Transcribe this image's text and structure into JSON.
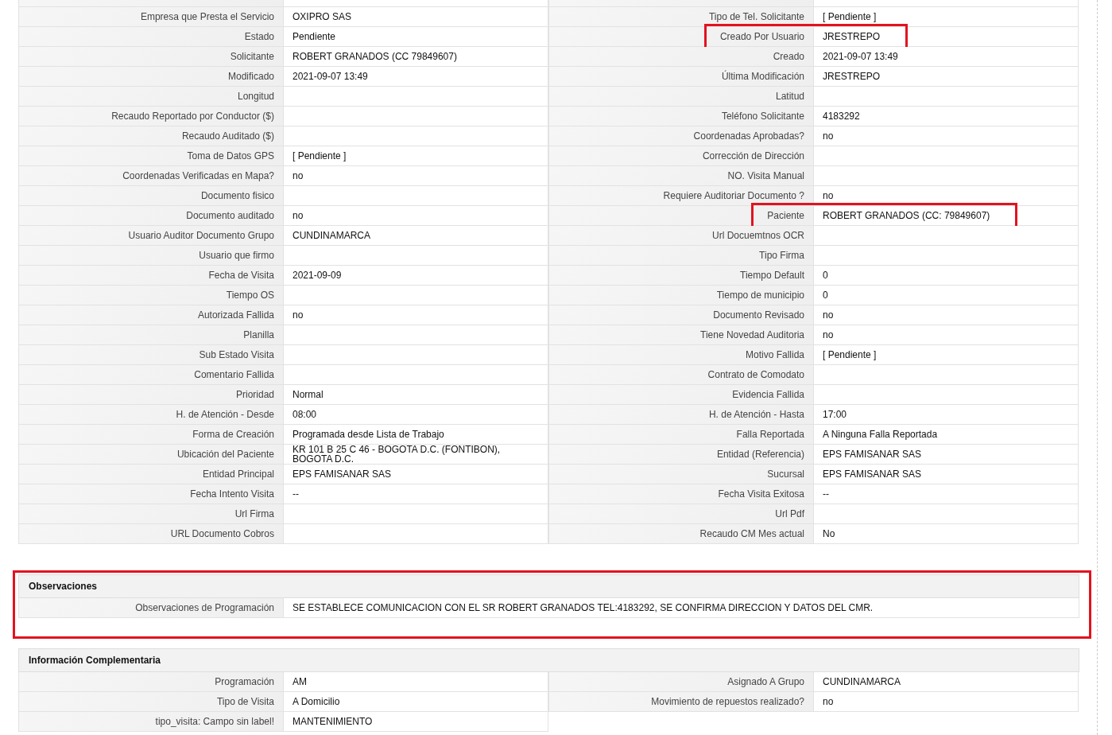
{
  "details": {
    "rows": [
      {
        "left": {
          "label": "Empresa que Presta el Servicio",
          "value": "OXIPRO SAS",
          "highlighted": false
        },
        "right": {
          "label": "Tipo de Tel. Solicitante",
          "value": "[ Pendiente ]",
          "highlighted": false
        }
      },
      {
        "left": {
          "label": "Estado",
          "value": "Pendiente",
          "highlighted": false
        },
        "right": {
          "label": "Creado Por Usuario",
          "value": "JRESTREPO",
          "highlighted": true
        }
      },
      {
        "left": {
          "label": "Solicitante",
          "value": "ROBERT GRANADOS (CC 79849607)",
          "highlighted": false
        },
        "right": {
          "label": "Creado",
          "value": "2021-09-07 13:49",
          "highlighted": false
        }
      },
      {
        "left": {
          "label": "Modificado",
          "value": "2021-09-07 13:49",
          "highlighted": false
        },
        "right": {
          "label": "Última Modificación",
          "value": "JRESTREPO",
          "highlighted": false
        }
      },
      {
        "left": {
          "label": "Longitud",
          "highlighted": false
        },
        "right": {
          "label": "Latitud",
          "highlighted": false
        }
      },
      {
        "left": {
          "label": "Recaudo Reportado por Conductor ($)",
          "highlighted": false
        },
        "right": {
          "label": "Teléfono Solicitante",
          "value": "4183292",
          "highlighted": false
        }
      },
      {
        "left": {
          "label": "Recaudo Auditado ($)",
          "highlighted": false
        },
        "right": {
          "label": "Coordenadas Aprobadas?",
          "value": "no",
          "highlighted": false
        }
      },
      {
        "left": {
          "label": "Toma de Datos GPS",
          "value": "[ Pendiente ]",
          "highlighted": false
        },
        "right": {
          "label": "Corrección de Dirección",
          "highlighted": false
        }
      },
      {
        "left": {
          "label": "Coordenadas Verificadas en Mapa?",
          "value": "no",
          "highlighted": false
        },
        "right": {
          "label": "NO. Visita Manual",
          "highlighted": false
        }
      },
      {
        "left": {
          "label": "Documento fisico",
          "highlighted": false
        },
        "right": {
          "label": "Requiere Auditoriar Documento ?",
          "value": "no",
          "highlighted": false
        }
      },
      {
        "left": {
          "label": "Documento auditado",
          "value": "no",
          "highlighted": false
        },
        "right": {
          "label": "Paciente",
          "value": "ROBERT GRANADOS (CC: 79849607)",
          "highlighted": true
        }
      },
      {
        "left": {
          "label": "Usuario Auditor Documento Grupo",
          "value": "CUNDINAMARCA",
          "highlighted": false
        },
        "right": {
          "label": "Url Docuemtnos OCR",
          "highlighted": false
        }
      },
      {
        "left": {
          "label": "Usuario que firmo",
          "highlighted": false
        },
        "right": {
          "label": "Tipo Firma",
          "highlighted": false
        }
      },
      {
        "left": {
          "label": "Fecha de Visita",
          "value": "2021-09-09",
          "highlighted": false
        },
        "right": {
          "label": "Tiempo Default",
          "value": "0",
          "highlighted": false
        }
      },
      {
        "left": {
          "label": "Tiempo OS",
          "highlighted": false
        },
        "right": {
          "label": "Tiempo de municipio",
          "value": "0",
          "highlighted": false
        }
      },
      {
        "left": {
          "label": "Autorizada Fallida",
          "value": "no",
          "highlighted": false
        },
        "right": {
          "label": "Documento Revisado",
          "value": "no",
          "highlighted": false
        }
      },
      {
        "left": {
          "label": "Planilla",
          "highlighted": false
        },
        "right": {
          "label": "Tiene Novedad Auditoria",
          "value": "no",
          "highlighted": false
        }
      },
      {
        "left": {
          "label": "Sub Estado Visita",
          "highlighted": false
        },
        "right": {
          "label": "Motivo Fallida",
          "value": "[ Pendiente ]",
          "highlighted": false
        }
      },
      {
        "left": {
          "label": "Comentario Fallida",
          "highlighted": false
        },
        "right": {
          "label": "Contrato de Comodato",
          "highlighted": false
        }
      },
      {
        "left": {
          "label": "Prioridad",
          "value": "Normal",
          "highlighted": false
        },
        "right": {
          "label": "Evidencia Fallida",
          "highlighted": false
        }
      },
      {
        "left": {
          "label": "H. de Atención - Desde",
          "value": "08:00",
          "highlighted": false
        },
        "right": {
          "label": "H. de Atención - Hasta",
          "value": "17:00",
          "highlighted": false
        }
      },
      {
        "left": {
          "label": "Forma de Creación",
          "value": "Programada desde Lista de Trabajo",
          "highlighted": false
        },
        "right": {
          "label": "Falla Reportada",
          "value": "A Ninguna Falla Reportada",
          "highlighted": false
        }
      },
      {
        "left": {
          "label": "Ubicación del Paciente",
          "value": "KR 101 B 25 C 46 - BOGOTA D.C. (FONTIBON), BOGOTA D.C.",
          "highlighted": false
        },
        "right": {
          "label": "Entidad (Referencia)",
          "value": "EPS FAMISANAR SAS",
          "highlighted": false
        }
      },
      {
        "left": {
          "label": "Entidad Principal",
          "value": "EPS FAMISANAR SAS",
          "highlighted": false
        },
        "right": {
          "label": "Sucursal",
          "value": "EPS FAMISANAR SAS",
          "highlighted": false
        }
      },
      {
        "left": {
          "label": "Fecha Intento Visita",
          "value": "--",
          "highlighted": false
        },
        "right": {
          "label": "Fecha Visita Exitosa",
          "value": "--",
          "highlighted": false
        }
      },
      {
        "left": {
          "label": "Url Firma",
          "highlighted": false
        },
        "right": {
          "label": "Url Pdf",
          "highlighted": false
        }
      },
      {
        "left": {
          "label": "URL Documento Cobros",
          "highlighted": false
        },
        "right": {
          "label": "Recaudo CM Mes actual",
          "value": "No",
          "highlighted": false
        }
      }
    ]
  },
  "observations": {
    "title": "Observaciones",
    "highlighted": true,
    "rows": [
      {
        "label": "Observaciones de Programación",
        "value": "SE ESTABLECE COMUNICACION CON EL SR ROBERT GRANADOS TEL:4183292, SE CONFIRMA DIRECCION Y DATOS DEL CMR."
      }
    ]
  },
  "complementary": {
    "title": "Información Complementaria",
    "highlighted": false,
    "rows": [
      {
        "left": {
          "label": "Programación",
          "value": "AM",
          "highlighted": false
        },
        "right": {
          "label": "Asignado A Grupo",
          "value": "CUNDINAMARCA",
          "highlighted": false
        }
      },
      {
        "left": {
          "label": "Tipo de Visita",
          "value": "A Domicilio",
          "highlighted": false
        },
        "right": {
          "label": "Movimiento de repuestos realizado?",
          "value": "no",
          "highlighted": false
        }
      },
      {
        "left": {
          "label": "tipo_visita: Campo sin label!",
          "value": "MANTENIMIENTO",
          "highlighted": false
        }
      }
    ]
  }
}
